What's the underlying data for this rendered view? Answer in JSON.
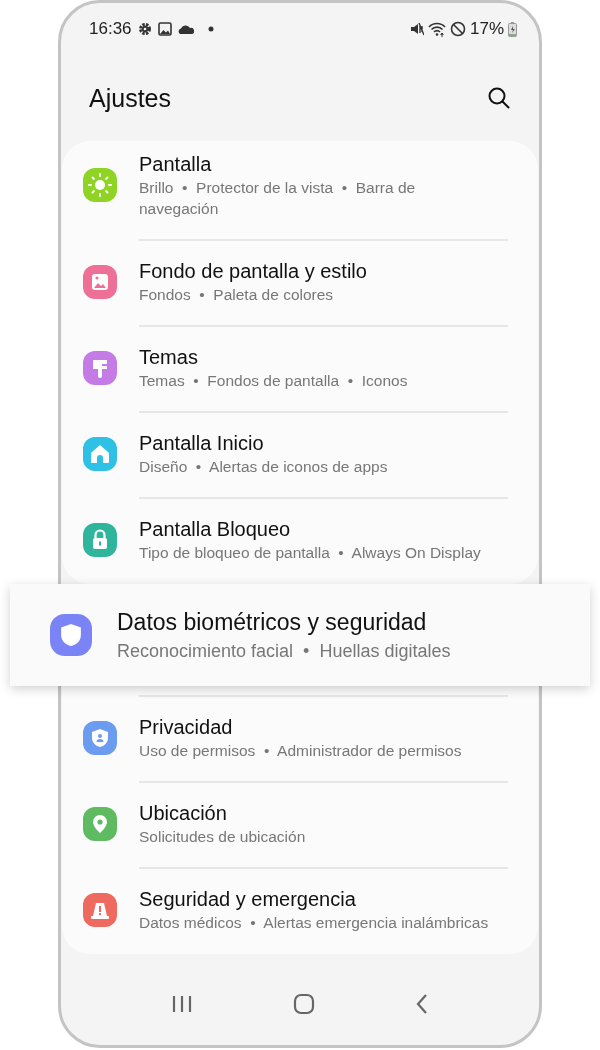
{
  "status_bar": {
    "time": "16:36",
    "battery": "17%"
  },
  "header": {
    "title": "Ajustes"
  },
  "cards": [
    {
      "items": [
        {
          "title": "Pantalla",
          "subtitle": "Brillo  •  Protector de la vista  •  Barra de navegación",
          "color": "#8fd424"
        },
        {
          "title": "Fondo de pantalla y estilo",
          "subtitle": "Fondos  •  Paleta de colores",
          "color": "#ef7096"
        },
        {
          "title": "Temas",
          "subtitle": "Temas  •  Fondos de pantalla  •  Iconos",
          "color": "#c57be6"
        },
        {
          "title": "Pantalla Inicio",
          "subtitle": "Diseño  •  Alertas de iconos de apps",
          "color": "#2fc0e6"
        },
        {
          "title": "Pantalla Bloqueo",
          "subtitle": "Tipo de bloqueo de pantalla  •  Always On Display",
          "color": "#2fb59c"
        }
      ]
    },
    {
      "items": [
        {
          "title": "Privacidad",
          "subtitle": "Uso de permisos  •  Administrador de permisos",
          "color": "#6b9cf0"
        },
        {
          "title": "Ubicación",
          "subtitle": "Solicitudes de ubicación",
          "color": "#5fbb62"
        },
        {
          "title": "Seguridad y emergencia",
          "subtitle": "Datos médicos  •  Alertas emergencia inalámbricas",
          "color": "#ee6a5f"
        }
      ]
    }
  ],
  "highlighted_item": {
    "title": "Datos biométricos y seguridad",
    "subtitle": "Reconocimiento facial  •  Huellas digitales",
    "color": "#7a84f7"
  }
}
